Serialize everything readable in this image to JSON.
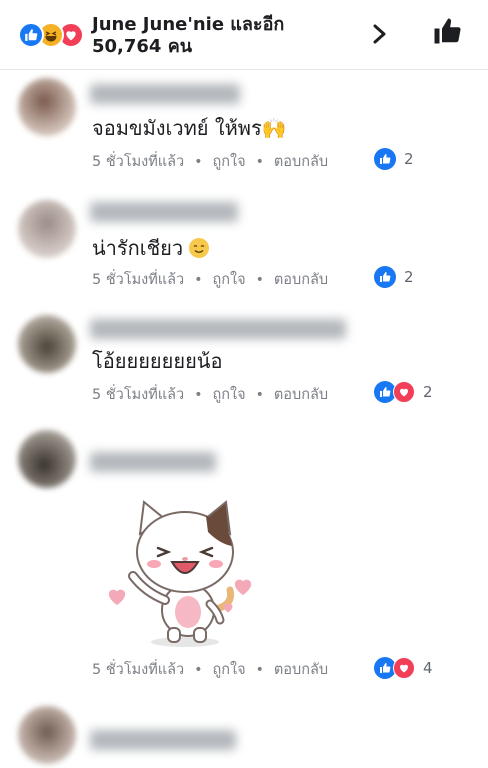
{
  "header": {
    "summary": "June June'nie และอีก 50,764 คน",
    "reactions": [
      "like-icon",
      "haha-icon",
      "love-icon"
    ]
  },
  "comments": [
    {
      "text": "จอมขมังเวทย์ ให้พร🙌",
      "time": "5 ชั่วโมงที่แล้ว",
      "like": "ถูกใจ",
      "reply": "ตอบกลับ",
      "reaction_count": "2",
      "reactions": [
        "like"
      ]
    },
    {
      "text": "น่ารักเชียว",
      "time": "5 ชั่วโมงที่แล้ว",
      "like": "ถูกใจ",
      "reply": "ตอบกลับ",
      "reaction_count": "2",
      "reactions": [
        "like"
      ]
    },
    {
      "text": "โอ้ยยยยยยยน้อ",
      "time": "5 ชั่วโมงที่แล้ว",
      "like": "ถูกใจ",
      "reply": "ตอบกลับ",
      "reaction_count": "2",
      "reactions": [
        "like",
        "love"
      ]
    },
    {
      "text": "",
      "sticker": "waving-cat-sticker",
      "time": "5 ชั่วโมงที่แล้ว",
      "like": "ถูกใจ",
      "reply": "ตอบกลับ",
      "reaction_count": "4",
      "reactions": [
        "like",
        "love"
      ]
    }
  ],
  "colors": {
    "like_blue": "#1877f2",
    "love_red": "#f33e58",
    "haha_yellow": "#f7b125",
    "meta_gray": "#7b7f86"
  }
}
